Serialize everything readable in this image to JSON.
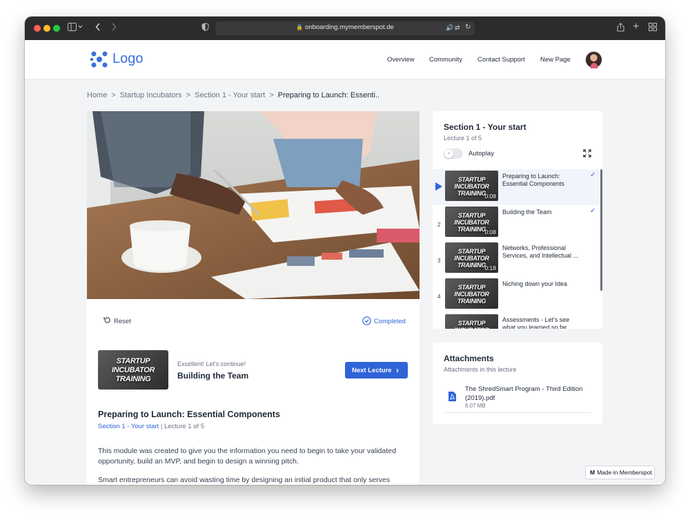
{
  "browser": {
    "url": "onboarding.mymemberspot.de"
  },
  "nav": {
    "logo": "Logo",
    "links": [
      "Overview",
      "Community",
      "Contact Support",
      "New Page"
    ]
  },
  "breadcrumb": {
    "items": [
      "Home",
      "Startup Incubators",
      "Section 1 - Your start"
    ],
    "current": "Preparing to Launch: Essenti..",
    "separator": ">"
  },
  "player": {
    "reset_label": "Reset",
    "completed_label": "Completed"
  },
  "next_lecture": {
    "thumb_text": "STARTUP INCUBATOR TRAINING",
    "eyebrow": "Excellent! Let's continue!",
    "title": "Building the Team",
    "button": "Next Lecture"
  },
  "lecture": {
    "title": "Preparing to Launch: Essential Components",
    "section_link": "Section 1 - Your start",
    "position": "Lecture 1 of 5",
    "paragraphs": [
      "This module was created to give you the information you need to begin to take your validated opportunity, build an MVP, and begin to design a winning pitch.",
      "Smart entrepreneurs can avoid wasting time by designing an initial product that only serves"
    ]
  },
  "playlist": {
    "title": "Section 1 - Your start",
    "subtitle": "Lecture 1 of 5",
    "autoplay_label": "Autoplay",
    "autoplay_on": false,
    "items": [
      {
        "num": "",
        "thumb": "STARTUP INCUBATOR TRAINING",
        "duration": "0:08",
        "title": "Preparing to Launch: Essential Components",
        "completed": true,
        "active": true
      },
      {
        "num": "2",
        "thumb": "STARTUP INCUBATOR TRAINING",
        "duration": "0:08",
        "title": "Building the Team",
        "completed": true,
        "active": false
      },
      {
        "num": "3",
        "thumb": "STARTUP INCUBATOR TRAINING",
        "duration": "0:18",
        "title": "Networks, Professional Services, and Intellectual ...",
        "completed": false,
        "active": false
      },
      {
        "num": "4",
        "thumb": "STARTUP INCUBATOR TRAINING",
        "duration": "",
        "title": "Niching down your Idea",
        "completed": false,
        "active": false
      },
      {
        "num": "",
        "thumb": "STARTUP INCUBATOR",
        "duration": "",
        "title": "Assessments - Let's see what you learned so far.",
        "completed": false,
        "active": false
      }
    ]
  },
  "attachments": {
    "title": "Attachments",
    "subtitle": "Attachments in this lecture",
    "files": [
      {
        "name": "The ShredSmart Program - Third Edition (2019).pdf",
        "size": "6.07 MB"
      }
    ]
  },
  "badge": {
    "logo": "M",
    "text": "Made in Memberspot"
  },
  "colors": {
    "accent": "#2f63d8",
    "logo": "#3b6fe0",
    "page_bg": "#f3f4f6"
  }
}
